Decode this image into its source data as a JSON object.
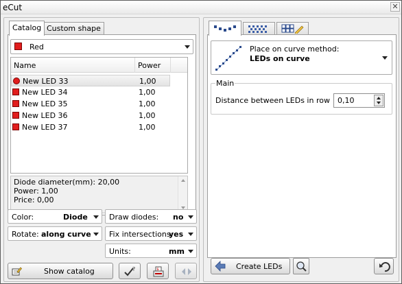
{
  "window": {
    "title": "eCut",
    "close_glyph": "✕"
  },
  "left": {
    "tabs": [
      "Catalog",
      "Custom shape"
    ],
    "color_select": {
      "value": "Red",
      "swatch_color": "#e11e1e"
    },
    "table": {
      "columns": [
        "Name",
        "Power"
      ],
      "rows": [
        {
          "name": "New LED 33",
          "power": "1,00",
          "marker": "dot",
          "selected": true
        },
        {
          "name": "New LED 34",
          "power": "1,00",
          "marker": "square"
        },
        {
          "name": "New LED 35",
          "power": "1,00",
          "marker": "square"
        },
        {
          "name": "New LED 36",
          "power": "1,00",
          "marker": "square"
        },
        {
          "name": "New LED 37",
          "power": "1,00",
          "marker": "square"
        }
      ]
    },
    "info": {
      "line1": "Diode diameter(mm): 20,00",
      "line2": "Power: 1,00",
      "line3": "Price: 0,00"
    },
    "options": {
      "color": {
        "label": "Color:",
        "value": "Diode"
      },
      "draw_diodes": {
        "label": "Draw diodes:",
        "value": "no"
      },
      "rotate": {
        "label": "Rotate:",
        "value": "along curve"
      },
      "fix_intersections": {
        "label": "Fix intersections:",
        "value": "yes"
      },
      "units": {
        "label": "Units:",
        "value": "mm"
      }
    },
    "buttons": {
      "show_catalog": "Show catalog"
    }
  },
  "right": {
    "tab_icons": [
      "led-line-icon",
      "led-fill-icon",
      "led-grid-edit-icon"
    ],
    "method": {
      "label": "Place on curve method:",
      "value": "LEDs on curve"
    },
    "group": {
      "title": "Main",
      "distance_label": "Distance between LEDs in row",
      "distance_value": "0,10"
    },
    "buttons": {
      "create": "Create LEDs"
    }
  }
}
